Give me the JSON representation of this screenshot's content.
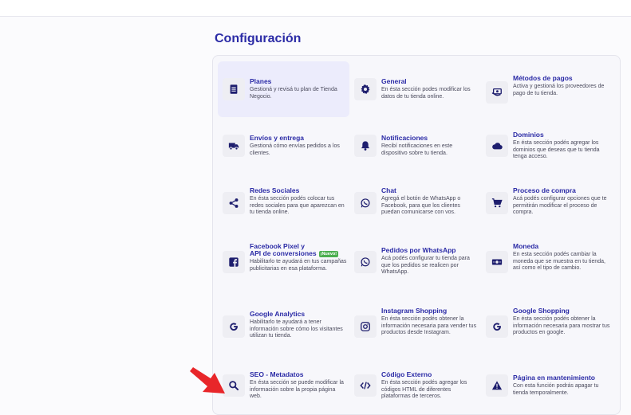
{
  "page": {
    "title": "Configuración"
  },
  "colors": {
    "accent": "#2b2ba6",
    "icon": "#1e1e6e",
    "badge": "#4caf50",
    "arrow": "#e8262a"
  },
  "items": [
    {
      "title": "Planes",
      "desc": "Gestioná y revisá tu plan de Tienda Negocio.",
      "icon": "document-icon",
      "active": true
    },
    {
      "title": "General",
      "desc": "En ésta sección podes modificar los datos de tu tienda online.",
      "icon": "gear-icon"
    },
    {
      "title": "Métodos de pagos",
      "desc": "Activa y gestioná los proveedores de pago de tu tienda.",
      "icon": "money-hand-icon"
    },
    {
      "title": "Envíos y entrega",
      "desc": "Gestioná cómo envías pedidos a los clientes.",
      "icon": "truck-icon"
    },
    {
      "title": "Notificaciones",
      "desc": "Recibí notificaciones en este dispositivo sobre tu tienda.",
      "icon": "bell-icon"
    },
    {
      "title": "Dominios",
      "desc": "En ésta sección podés agregar los dominios que deseas que tu tienda tenga acceso.",
      "icon": "cloud-icon"
    },
    {
      "title": "Redes Sociales",
      "desc": "En ésta sección podés colocar tus redes sociales para que aparezcan en tu tienda online.",
      "icon": "share-icon"
    },
    {
      "title": "Chat",
      "desc": "Agregá el botón de WhatsApp o Facebook, para que los clientes puedan comunicarse con vos.",
      "icon": "whatsapp-icon"
    },
    {
      "title": "Proceso de compra",
      "desc": "Acá podés configurar opciones que te permitirán modificar el proceso de compra.",
      "icon": "cart-icon"
    },
    {
      "title": "Facebook Pixel y",
      "title2": "API de conversiones",
      "badge": "¡Nuevo!",
      "desc": "Habilitarlo te ayudará en tus campañas publicitarias en esa plataforma.",
      "icon": "facebook-icon"
    },
    {
      "title": "Pedidos por WhatsApp",
      "desc": "Acá podés configurar tu tienda para que los pedidos se realicen por WhatsApp.",
      "icon": "whatsapp-icon"
    },
    {
      "title": "Moneda",
      "desc": "En esta sección podés cambiar la moneda que se muestra en tu tienda, así como el tipo de cambio.",
      "icon": "banknote-icon"
    },
    {
      "title": "Google Analytics",
      "desc": "Habilitarlo te ayudará a tener información sobre cómo los visitantes utilizan tu tienda.",
      "icon": "google-icon"
    },
    {
      "title": "Instagram Shopping",
      "desc": "En ésta sección podés obtener la información necesaria para vender tus productos desde Instagram.",
      "icon": "instagram-icon"
    },
    {
      "title": "Google Shopping",
      "desc": "En ésta sección podés obtener la información necesaria para mostrar tus productos en google.",
      "icon": "google-icon"
    },
    {
      "title": "SEO - Metadatos",
      "desc": "En ésta sección se puede modificar la información sobre la propia página web.",
      "icon": "search-icon"
    },
    {
      "title": "Código Externo",
      "desc": "En ésta sección podés agregar los códigos HTML de diferentes plataformas de terceros.",
      "icon": "code-icon"
    },
    {
      "title": "Página en mantenimiento",
      "desc": "Con esta función podrás apagar tu tienda temporalmente.",
      "icon": "warning-icon"
    }
  ]
}
